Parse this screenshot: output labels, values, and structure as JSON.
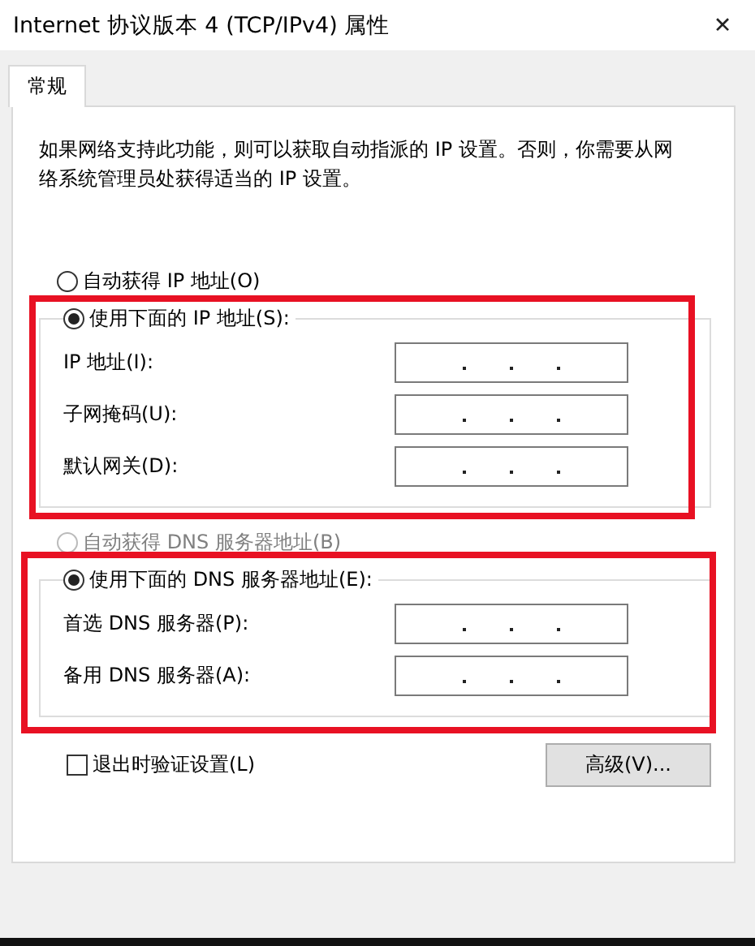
{
  "window": {
    "title": "Internet 协议版本 4 (TCP/IPv4) 属性",
    "close": "✕"
  },
  "tabs": [
    {
      "label": "常规",
      "selected": true
    }
  ],
  "description": "如果网络支持此功能，则可以获取自动指派的 IP 设置。否则，你需要从网络系统管理员处获得适当的 IP 设置。",
  "options": [
    {
      "kind": "radio",
      "label": "自动获得 IP 地址(O)",
      "selected": false,
      "disabled": false
    },
    {
      "kind": "group",
      "label": "使用下面的 IP 地址(S):",
      "selected": true,
      "disabled": false,
      "highlighted": true,
      "fields": [
        {
          "label": "IP 地址(I):"
        },
        {
          "label": "子网掩码(U):"
        },
        {
          "label": "默认网关(D):"
        }
      ]
    },
    {
      "kind": "radio",
      "label": "自动获得 DNS 服务器地址(B)",
      "selected": false,
      "disabled": true
    },
    {
      "kind": "group",
      "label": "使用下面的 DNS 服务器地址(E):",
      "selected": true,
      "disabled": false,
      "highlighted": true,
      "fields": [
        {
          "label": "首选 DNS 服务器(P):"
        },
        {
          "label": "备用 DNS 服务器(A):"
        }
      ]
    }
  ],
  "validate": {
    "label": "退出时验证设置(L)",
    "checked": false
  },
  "advanced_button": "高级(V)..."
}
